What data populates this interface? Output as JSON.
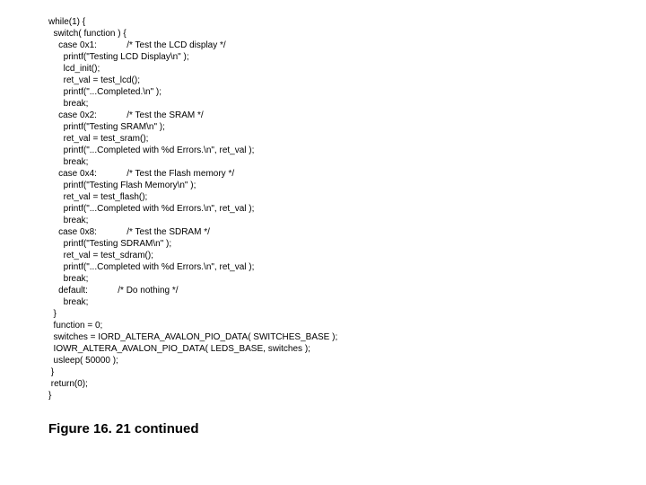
{
  "code": "while(1) {\n  switch( function ) {\n    case 0x1:            /* Test the LCD display */\n      printf(\"Testing LCD Display\\n\" );\n      lcd_init();\n      ret_val = test_lcd();\n      printf(\"...Completed.\\n\" );\n      break;\n    case 0x2:            /* Test the SRAM */\n      printf(\"Testing SRAM\\n\" );\n      ret_val = test_sram();\n      printf(\"...Completed with %d Errors.\\n\", ret_val );\n      break;\n    case 0x4:            /* Test the Flash memory */\n      printf(\"Testing Flash Memory\\n\" );\n      ret_val = test_flash();\n      printf(\"...Completed with %d Errors.\\n\", ret_val );\n      break;\n    case 0x8:            /* Test the SDRAM */\n      printf(\"Testing SDRAM\\n\" );\n      ret_val = test_sdram();\n      printf(\"...Completed with %d Errors.\\n\", ret_val );\n      break;\n    default:            /* Do nothing */\n      break;\n  }\n  function = 0;\n  switches = IORD_ALTERA_AVALON_PIO_DATA( SWITCHES_BASE );\n  IOWR_ALTERA_AVALON_PIO_DATA( LEDS_BASE, switches );\n  usleep( 50000 );\n }\n return(0);\n}",
  "caption": "Figure 16. 21 continued"
}
